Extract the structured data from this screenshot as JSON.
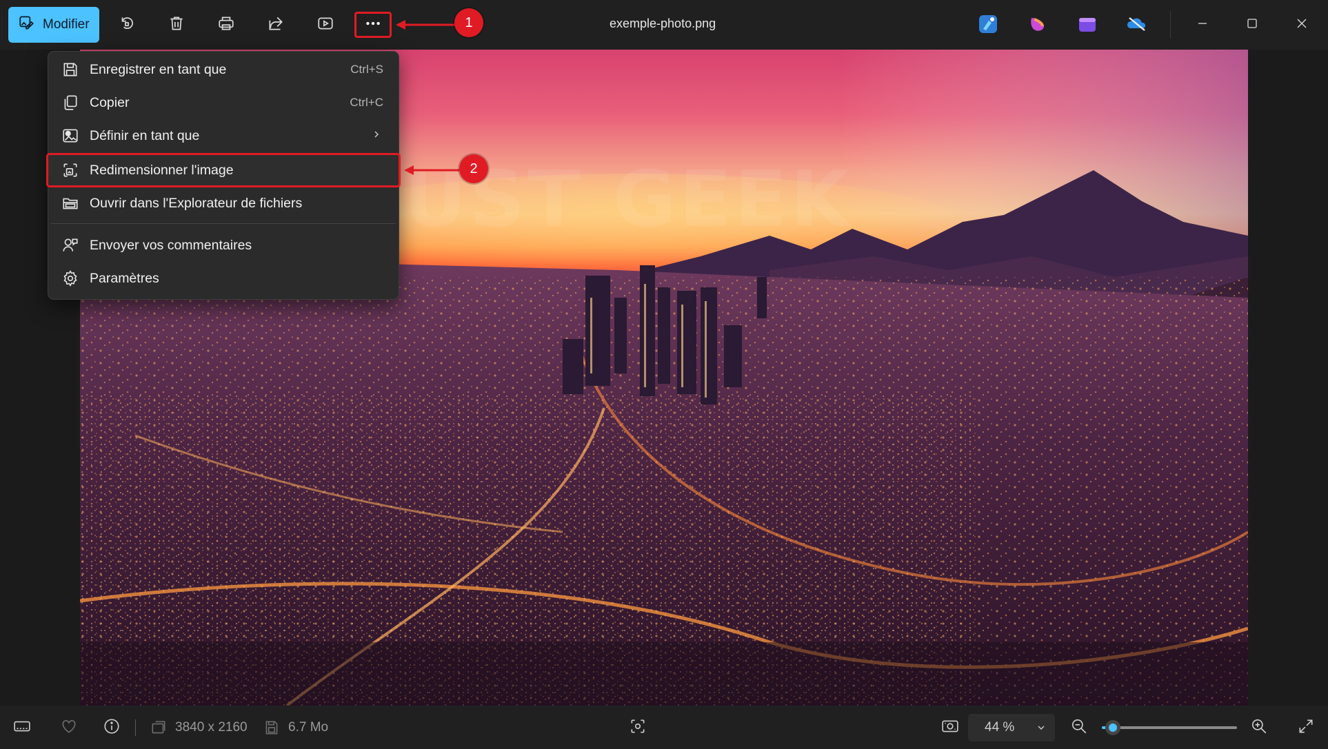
{
  "window": {
    "title": "exemple-photo.png"
  },
  "toolbar": {
    "edit_label": "Modifier",
    "buttons": [
      "rotate-icon",
      "delete-icon",
      "print-icon",
      "share-icon",
      "slideshow-icon",
      "more-icon"
    ],
    "app_icons": [
      "designer-icon",
      "clipchamp-alt-icon",
      "clipchamp-icon",
      "onedrive-icon"
    ]
  },
  "context_menu": {
    "items": [
      {
        "label": "Enregistrer en tant que",
        "shortcut": "Ctrl+S",
        "icon": "save-icon"
      },
      {
        "label": "Copier",
        "shortcut": "Ctrl+C",
        "icon": "copy-icon"
      },
      {
        "label": "Définir en tant que",
        "shortcut": "",
        "icon": "set-as-icon"
      },
      {
        "label": "Redimensionner l'image",
        "shortcut": "",
        "icon": "resize-icon"
      },
      {
        "label": "Ouvrir dans l'Explorateur de fichiers",
        "shortcut": "",
        "icon": "folder-icon"
      },
      {
        "label": "Envoyer vos commentaires",
        "shortcut": "",
        "icon": "feedback-icon"
      },
      {
        "label": "Paramètres",
        "shortcut": "",
        "icon": "settings-icon"
      }
    ]
  },
  "annotations": {
    "badge_1": "1",
    "badge_2": "2"
  },
  "image": {
    "watermark": "JUST GEEK"
  },
  "statusbar": {
    "dimensions": "3840 x 2160",
    "file_size": "6.7 Mo",
    "zoom_label": "44 %",
    "zoom_fraction": 0.08
  },
  "colors": {
    "accent": "#4cc2ff",
    "annotation_red": "#e01b24",
    "menu_bg": "#2b2b2b",
    "window_bg": "#202020"
  }
}
